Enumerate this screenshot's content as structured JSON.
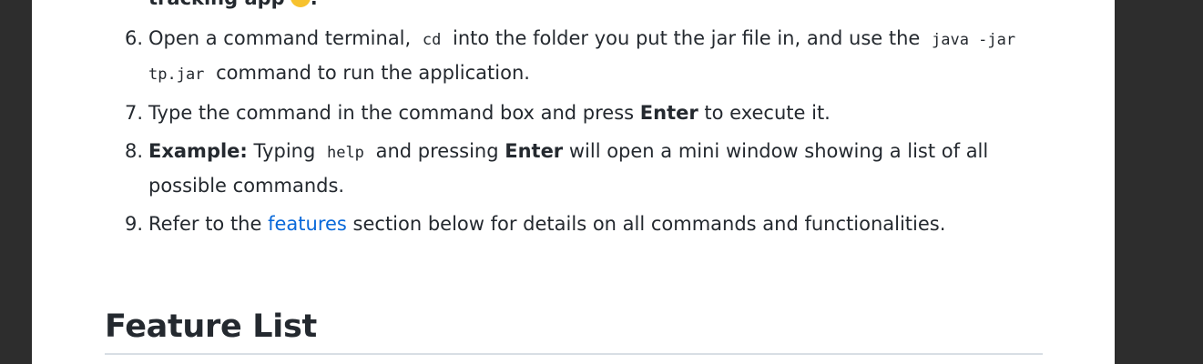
{
  "clipped_line": {
    "text": "tracking app",
    "emoji_icon": "smiling-face-emoji",
    "trailing": "."
  },
  "steps": [
    {
      "number": "6.",
      "parts": {
        "t1": "Open a command terminal, ",
        "code1": "cd",
        "t2": " into the folder you put the jar file in, and use the ",
        "code2": "java -jar",
        "code3": "tp.jar",
        "t3": " command to run the application."
      }
    },
    {
      "number": "7.",
      "parts": {
        "t1": "Type the command in the command box and press ",
        "b1": "Enter",
        "t2": " to execute it."
      }
    },
    {
      "number": "8.",
      "parts": {
        "b1": "Example:",
        "t1": " Typing ",
        "code1": "help",
        "t2": " and pressing ",
        "b2": "Enter",
        "t3": " will open a mini window showing a list of all possible commands."
      }
    },
    {
      "number": "9.",
      "parts": {
        "t1": "Refer to the ",
        "link": "features",
        "t2": " section below for details on all commands and functionalities."
      }
    }
  ],
  "heading": "Feature List",
  "colors": {
    "sidebar": "#2d2d2d",
    "link": "#0969da",
    "text": "#24292f",
    "rule": "#d8dee4"
  }
}
